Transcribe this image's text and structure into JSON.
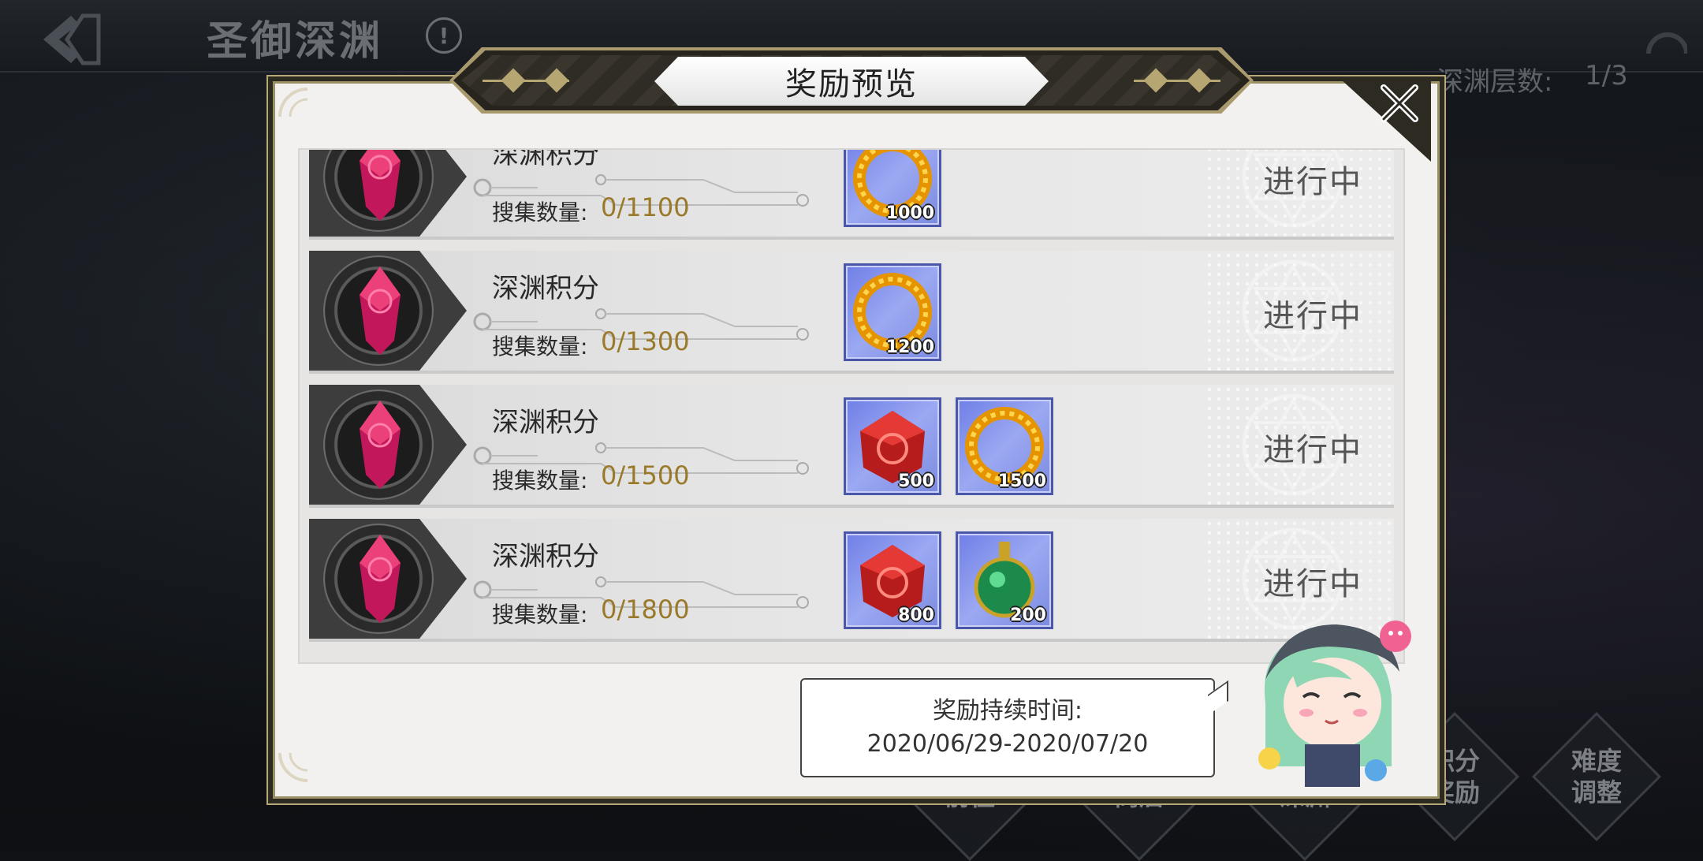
{
  "scene": {
    "title": "圣御深渊",
    "info_icon": "!",
    "floor_label": "深渊层数:",
    "floor_value": "1/3",
    "bottom_buttons": [
      "前往",
      "商店",
      "深渊",
      "积分奖励",
      "难度调整"
    ]
  },
  "modal": {
    "title": "奖励预览",
    "close_icon": "close-icon"
  },
  "rewards": [
    {
      "title": "深渊积分",
      "count_label": "搜集数量:",
      "count_value": "0/1100",
      "status": "进行中",
      "items": [
        {
          "icon": "gold-ring-icon",
          "qty": "1000"
        }
      ]
    },
    {
      "title": "深渊积分",
      "count_label": "搜集数量:",
      "count_value": "0/1300",
      "status": "进行中",
      "items": [
        {
          "icon": "gold-ring-icon",
          "qty": "1200"
        }
      ]
    },
    {
      "title": "深渊积分",
      "count_label": "搜集数量:",
      "count_value": "0/1500",
      "status": "进行中",
      "items": [
        {
          "icon": "red-crystal-icon",
          "qty": "500"
        },
        {
          "icon": "gold-ring-icon",
          "qty": "1500"
        }
      ]
    },
    {
      "title": "深渊积分",
      "count_label": "搜集数量:",
      "count_value": "0/1800",
      "status": "进行中",
      "items": [
        {
          "icon": "red-crystal-icon",
          "qty": "800"
        },
        {
          "icon": "green-potion-icon",
          "qty": "200"
        }
      ]
    }
  ],
  "duration": {
    "label": "奖励持续时间:",
    "value": "2020/06/29-2020/07/20"
  },
  "colors": {
    "accent_gold": "#a89a6c",
    "count_value": "#9a7a2a",
    "item_tile": "#7b8be0"
  }
}
